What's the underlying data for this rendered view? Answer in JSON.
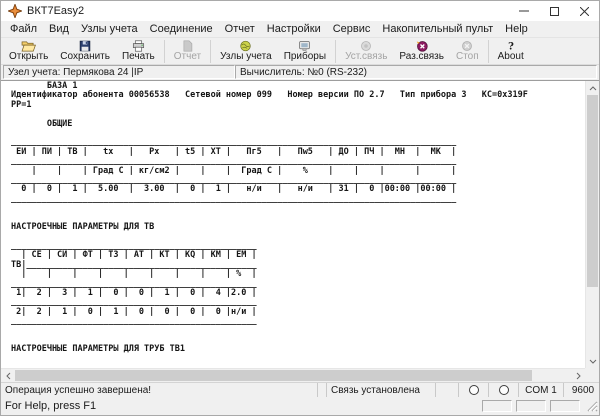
{
  "window": {
    "title": "ВКТ7Easy2"
  },
  "menu": {
    "items": [
      "Файл",
      "Вид",
      "Узлы учета",
      "Соединение",
      "Отчет",
      "Настройки",
      "Сервис",
      "Накопительный пульт",
      "Help"
    ]
  },
  "toolbar": {
    "buttons": [
      {
        "label": "Открыть",
        "icon": "open-folder-icon",
        "enabled": true
      },
      {
        "label": "Сохранить",
        "icon": "save-icon",
        "enabled": true
      },
      {
        "label": "Печать",
        "icon": "print-icon",
        "enabled": true
      },
      {
        "label": "Отчет",
        "icon": "report-icon",
        "enabled": false
      },
      {
        "label": "Узлы учета",
        "icon": "metering-nodes-icon",
        "enabled": true
      },
      {
        "label": "Приборы",
        "icon": "devices-icon",
        "enabled": true
      },
      {
        "label": "Уст.связь",
        "icon": "connect-icon",
        "enabled": false
      },
      {
        "label": "Раз.связь",
        "icon": "disconnect-icon",
        "enabled": true
      },
      {
        "label": "Стоп",
        "icon": "stop-icon",
        "enabled": false
      },
      {
        "label": "About",
        "icon": "about-icon",
        "enabled": true
      }
    ]
  },
  "infobar": {
    "node": "Узел учета: Пермякова 24  |IP",
    "computer": "Вычислитель: №0 (RS-232)"
  },
  "document": {
    "lines": [
      "       БАЗА 1",
      "Идентификатор абонента 00056538   Сетевой номер 099   Номер версии ПО 2.7   Тип прибора 3   КС=0x319F",
      "РР=1",
      "",
      "       ОБЩИЕ",
      "",
      "_______________________________________________________________________________________",
      " ЕИ | ПИ | ТВ |   tx   |   Px   | t5 | ХТ |   Пг5   |   Пw5   | ДО | ПЧ |  МН  |  МК  |",
      "_______________________________________________________________________________________",
      "    |    |    | Град С | кг/см2 |    |    |  Град С |    %    |    |    |      |      |",
      "_______________________________________________________________________________________",
      "  0 |  0 |  1 |  5.00  |  3.00  |  0 |  1 |   н/и   |   н/и   | 31 |  0 |00:00 |00:00 |",
      "_______________________________________________________________________________________",
      "",
      "",
      "НАСТРОЕЧНЫЕ ПАРАМЕТРЫ ДЛЯ ТВ",
      "",
      "________________________________________________",
      "  | СЕ | СИ | ФТ | ТЗ | АТ | КТ | КQ | КМ | ЕМ |",
      "ТВ|_____________________________________________",
      "  |    |    |    |    |    |    |    |    | %  |",
      "________________________________________________",
      " 1|  2 |  3 |  1 |  0 |  0 |  1 |  0 |  4 |2.0 |",
      "________________________________________________",
      " 2|  2 |  1 |  0 |  1 |  0 |  0 |  0 |  0 |н/и |",
      "________________________________________________",
      "",
      "",
      "НАСТРОЕЧНЫЕ ПАРАМЕТРЫ ДЛЯ ТРУБ ТВ1",
      "",
      "___________________________________________________________________________________"
    ]
  },
  "statusbar": {
    "message": "Операция успешно завершена!",
    "connection": "Связь установлена",
    "port": "COM 1",
    "baud": "9600"
  },
  "helpbar": {
    "text": "For Help, press F1"
  },
  "colors": {
    "chrome": "#f0f0f0",
    "disconnect_icon": "#8e1a62",
    "folder_icon": "#f2cd6a",
    "app_icon": "#c96a1e"
  }
}
